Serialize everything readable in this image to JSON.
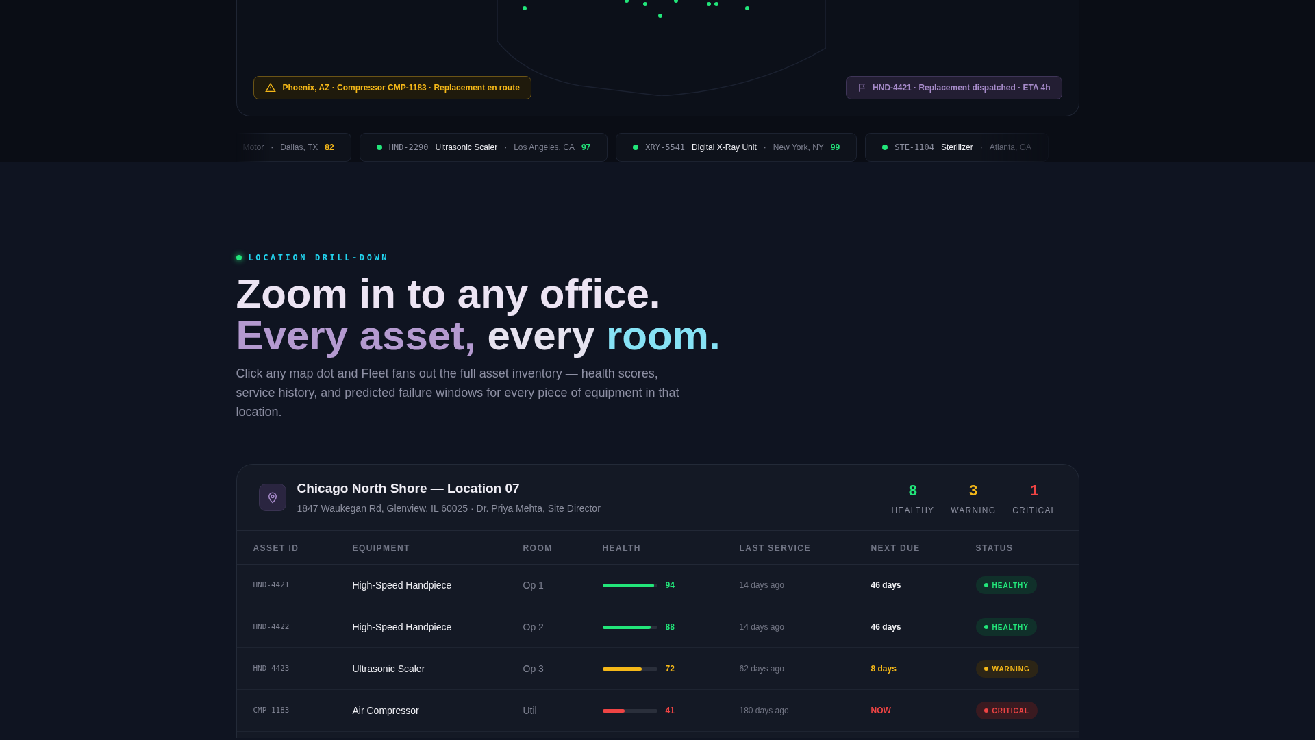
{
  "map": {
    "alerts": [
      {
        "kind": "warning",
        "text": "Phoenix, AZ · Compressor CMP-1183 · Replacement en route"
      },
      {
        "kind": "dispatch",
        "text": "HND-4421 · Replacement dispatched · ETA 4h"
      }
    ]
  },
  "ticker": [
    {
      "equipment": "Motor",
      "separator": "·",
      "city": "Dallas, TX",
      "score": "82",
      "color": "#f5b818"
    },
    {
      "asset_id": "HND-2290",
      "equipment": "Ultrasonic Scaler",
      "separator": "·",
      "city": "Los Angeles, CA",
      "score": "97",
      "color": "#22e67a"
    },
    {
      "asset_id": "XRY-5541",
      "equipment": "Digital X-Ray Unit",
      "separator": "·",
      "city": "New York, NY",
      "score": "99",
      "color": "#22e67a"
    },
    {
      "asset_id": "STE-1104",
      "equipment": "Sterilizer",
      "separator": "·",
      "city": "Atlanta, GA",
      "color": "#22e67a"
    }
  ],
  "section": {
    "eyebrow": "LOCATION DRILL-DOWN",
    "headline_line1": "Zoom in to any office.",
    "headline_line2": [
      {
        "text": "Every asset,",
        "color": "#b49ad0"
      },
      {
        "text": " every ",
        "color": "#e6e3ef"
      },
      {
        "text": "room.",
        "color": "#86e2f5"
      }
    ],
    "description": "Click any map dot and Fleet fans out the full asset inventory — health scores, service history, and predicted failure windows for every piece of equipment in that location."
  },
  "location": {
    "name": "Chicago North Shore — Location 07",
    "details": "1847 Waukegan Rd, Glenview, IL 60025 · Dr. Priya Mehta, Site Director",
    "stats": [
      {
        "value": "8",
        "label": "HEALTHY",
        "kind": "healthy"
      },
      {
        "value": "3",
        "label": "WARNING",
        "kind": "warning"
      },
      {
        "value": "1",
        "label": "CRITICAL",
        "kind": "critical"
      }
    ]
  },
  "table": {
    "columns": [
      "ASSET ID",
      "EQUIPMENT",
      "ROOM",
      "HEALTH",
      "LAST SERVICE",
      "NEXT DUE",
      "STATUS"
    ],
    "rows": [
      {
        "asset_id": "HND-4421",
        "equipment": "High-Speed Handpiece",
        "room": "Op 1",
        "level": 0.94,
        "reading": "94",
        "last_service": "14 days ago",
        "next_due": "46 days",
        "status": "HEALTHY",
        "kind": "healthy"
      },
      {
        "asset_id": "HND-4422",
        "equipment": "High-Speed Handpiece",
        "room": "Op 2",
        "level": 0.88,
        "reading": "88",
        "last_service": "14 days ago",
        "next_due": "46 days",
        "status": "HEALTHY",
        "kind": "healthy"
      },
      {
        "asset_id": "HND-4423",
        "equipment": "Ultrasonic Scaler",
        "room": "Op 3",
        "level": 0.72,
        "reading": "72",
        "last_service": "62 days ago",
        "next_due": "8 days",
        "status": "WARNING",
        "kind": "warning"
      },
      {
        "asset_id": "CMP-1183",
        "equipment": "Air Compressor",
        "room": "Util",
        "level": 0.41,
        "reading": "41",
        "last_service": "180 days ago",
        "next_due": "NOW",
        "status": "CRITICAL",
        "kind": "critical"
      }
    ]
  }
}
